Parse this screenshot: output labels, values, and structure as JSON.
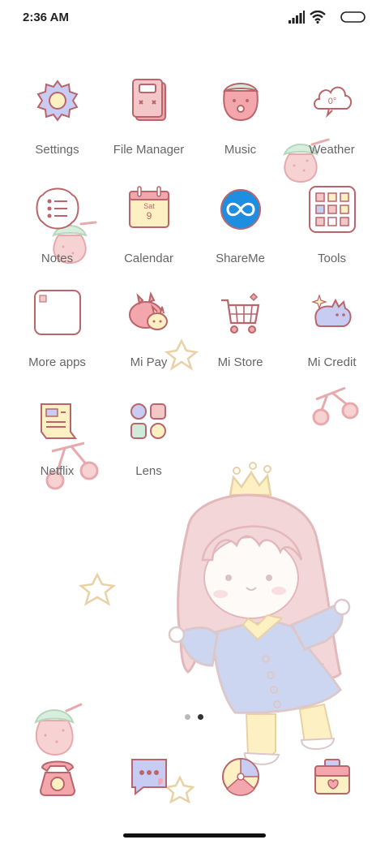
{
  "status_bar": {
    "time": "2:36 AM",
    "icons": [
      "signal-icon",
      "wifi-icon",
      "battery-icon"
    ]
  },
  "home_screen": {
    "apps": [
      {
        "label": "Settings",
        "icon": "gear-icon"
      },
      {
        "label": "File Manager",
        "icon": "folder-icon"
      },
      {
        "label": "Music",
        "icon": "strawberry-music-icon"
      },
      {
        "label": "Weather",
        "icon": "cloud-icon"
      },
      {
        "label": "Notes",
        "icon": "notes-icon"
      },
      {
        "label": "Calendar",
        "icon": "calendar-icon",
        "calendar_day": "Sat",
        "calendar_date": "9"
      },
      {
        "label": "ShareMe",
        "icon": "infinity-icon"
      },
      {
        "label": "Tools",
        "icon": "tools-grid-icon"
      },
      {
        "label": "More apps",
        "icon": "more-apps-folder-icon"
      },
      {
        "label": "Mi Pay",
        "icon": "bunny-wallet-icon"
      },
      {
        "label": "Mi Store",
        "icon": "cart-icon"
      },
      {
        "label": "Mi Credit",
        "icon": "cat-card-icon"
      },
      {
        "label": "Netflix",
        "icon": "scroll-icon"
      },
      {
        "label": "Lens",
        "icon": "lens-shapes-icon"
      }
    ],
    "weather_glyph": "0°"
  },
  "page_indicator": {
    "pages": 2,
    "current": 2
  },
  "dock": {
    "apps": [
      {
        "icon": "phone-icon"
      },
      {
        "icon": "message-icon"
      },
      {
        "icon": "ball-icon"
      },
      {
        "icon": "camera-icon"
      }
    ]
  },
  "colors": {
    "label": "#666666",
    "outline": "#b9656b",
    "pink": "#f3c7c8",
    "lavender": "#c8ccf2",
    "cream": "#fdf0c2",
    "mint": "#cfead9"
  }
}
